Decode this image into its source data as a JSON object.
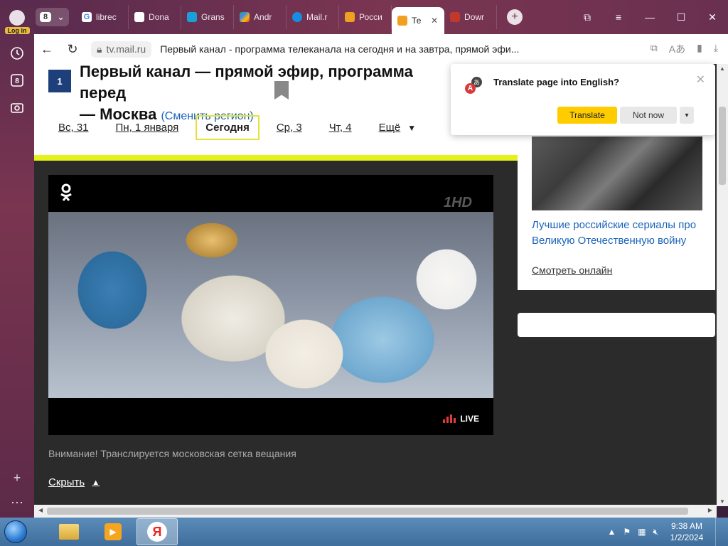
{
  "browser": {
    "tab_count": "8",
    "login_label": "Log in",
    "tabs": [
      {
        "label": "librec",
        "icon_color": "#ffffff"
      },
      {
        "label": "Dona",
        "icon_color": "#ffffff"
      },
      {
        "label": "Grans",
        "icon_color": "#1a9fd8"
      },
      {
        "label": "Andr",
        "icon_color": "#34a853"
      },
      {
        "label": "Mail.r",
        "icon_color": "#168de2"
      },
      {
        "label": "Росси",
        "icon_color": "#f0a020"
      },
      {
        "label": "Те",
        "icon_color": "#f0a020",
        "active": true
      },
      {
        "label": "Dowr",
        "icon_color": "#c0392b"
      }
    ],
    "url_domain": "tv.mail.ru",
    "page_title": "Первый канал - программа телеканала на сегодня и на завтра, прямой эфи..."
  },
  "page": {
    "channel_logo": "1",
    "title_line1": "Первый канал — прямой эфир, программа перед",
    "title_line2": "— Москва",
    "change_region": "(Сменить регион)",
    "day_tabs": [
      {
        "label": "Вс, 31"
      },
      {
        "label": "Пн, 1 января"
      },
      {
        "label": "Сегодня",
        "current": true
      },
      {
        "label": "Ср, 3"
      },
      {
        "label": "Чт, 4"
      },
      {
        "label": "Ещё"
      }
    ],
    "more_caret": "▼",
    "player": {
      "ok_icon": "ok",
      "hd_logo": "1HD",
      "live_label": "LIVE"
    },
    "notice": "Внимание! Транслируется московская сетка вещания",
    "hide_label": "Скрыть",
    "hide_caret": "▲",
    "ad": {
      "text": "Лучшие российские сериалы про Великую Отечественную войну",
      "link": "Смотреть онлайн"
    }
  },
  "translate_popup": {
    "title": "Translate page into English?",
    "translate_btn": "Translate",
    "not_now_btn": "Not now",
    "icon_letter_a": "A",
    "icon_letter_b": "あ"
  },
  "taskbar": {
    "time": "9:38 AM",
    "date": "1/2/2024",
    "yandex_letter": "Я"
  },
  "colors": {
    "accent_yellow": "#e4f21a",
    "link_blue": "#1a63b8",
    "translate_yellow": "#ffcc00",
    "sidebar_purple": "#6a3050"
  }
}
